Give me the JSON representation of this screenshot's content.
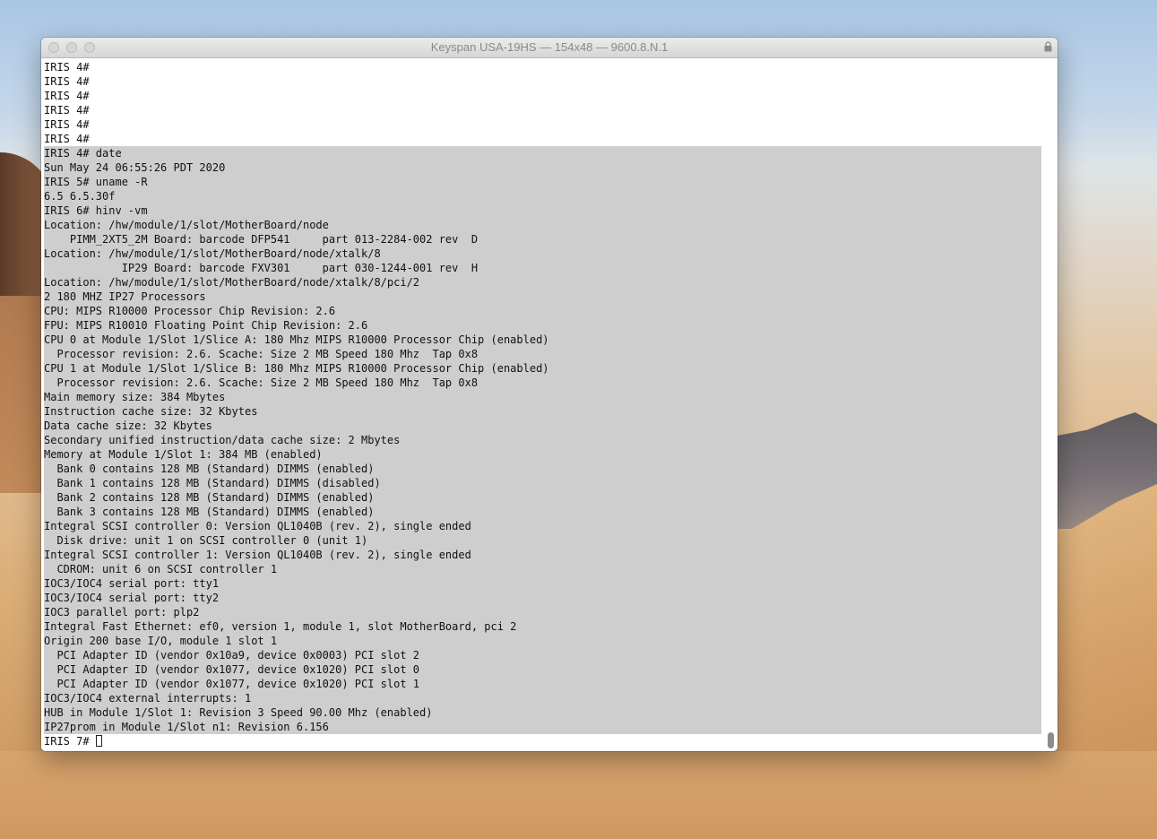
{
  "window": {
    "title": "Keyspan USA-19HS — 154x48 — 9600.8.N.1"
  },
  "terminal": {
    "prompt_lines": [
      "IRIS 4#",
      "IRIS 4#",
      "IRIS 4#",
      "IRIS 4#",
      "IRIS 4#",
      "IRIS 4#"
    ],
    "selected_lines": [
      "IRIS 4# date",
      "Sun May 24 06:55:26 PDT 2020",
      "IRIS 5# uname -R",
      "6.5 6.5.30f",
      "IRIS 6# hinv -vm",
      "Location: /hw/module/1/slot/MotherBoard/node",
      "    PIMM_2XT5_2M Board: barcode DFP541     part 013-2284-002 rev  D",
      "Location: /hw/module/1/slot/MotherBoard/node/xtalk/8",
      "            IP29 Board: barcode FXV301     part 030-1244-001 rev  H",
      "Location: /hw/module/1/slot/MotherBoard/node/xtalk/8/pci/2",
      "2 180 MHZ IP27 Processors",
      "CPU: MIPS R10000 Processor Chip Revision: 2.6",
      "FPU: MIPS R10010 Floating Point Chip Revision: 2.6",
      "CPU 0 at Module 1/Slot 1/Slice A: 180 Mhz MIPS R10000 Processor Chip (enabled)",
      "  Processor revision: 2.6. Scache: Size 2 MB Speed 180 Mhz  Tap 0x8",
      "CPU 1 at Module 1/Slot 1/Slice B: 180 Mhz MIPS R10000 Processor Chip (enabled)",
      "  Processor revision: 2.6. Scache: Size 2 MB Speed 180 Mhz  Tap 0x8",
      "Main memory size: 384 Mbytes",
      "Instruction cache size: 32 Kbytes",
      "Data cache size: 32 Kbytes",
      "Secondary unified instruction/data cache size: 2 Mbytes",
      "Memory at Module 1/Slot 1: 384 MB (enabled)",
      "  Bank 0 contains 128 MB (Standard) DIMMS (enabled)",
      "  Bank 1 contains 128 MB (Standard) DIMMS (disabled)",
      "  Bank 2 contains 128 MB (Standard) DIMMS (enabled)",
      "  Bank 3 contains 128 MB (Standard) DIMMS (enabled)",
      "Integral SCSI controller 0: Version QL1040B (rev. 2), single ended",
      "  Disk drive: unit 1 on SCSI controller 0 (unit 1)",
      "Integral SCSI controller 1: Version QL1040B (rev. 2), single ended",
      "  CDROM: unit 6 on SCSI controller 1",
      "IOC3/IOC4 serial port: tty1",
      "IOC3/IOC4 serial port: tty2",
      "IOC3 parallel port: plp2",
      "Integral Fast Ethernet: ef0, version 1, module 1, slot MotherBoard, pci 2",
      "Origin 200 base I/O, module 1 slot 1",
      "  PCI Adapter ID (vendor 0x10a9, device 0x0003) PCI slot 2",
      "  PCI Adapter ID (vendor 0x1077, device 0x1020) PCI slot 0",
      "  PCI Adapter ID (vendor 0x1077, device 0x1020) PCI slot 1",
      "IOC3/IOC4 external interrupts: 1",
      "HUB in Module 1/Slot 1: Revision 3 Speed 90.00 Mhz (enabled)",
      "IP27prom in Module 1/Slot n1: Revision 6.156"
    ],
    "current_prompt": "IRIS 7# "
  },
  "icons": {
    "lock": "lock-icon",
    "traffic_lights": [
      "close-button",
      "minimize-button",
      "zoom-button"
    ]
  },
  "colors": {
    "selection": "#cecece",
    "terminal_bg": "#ffffff",
    "text": "#111111"
  }
}
